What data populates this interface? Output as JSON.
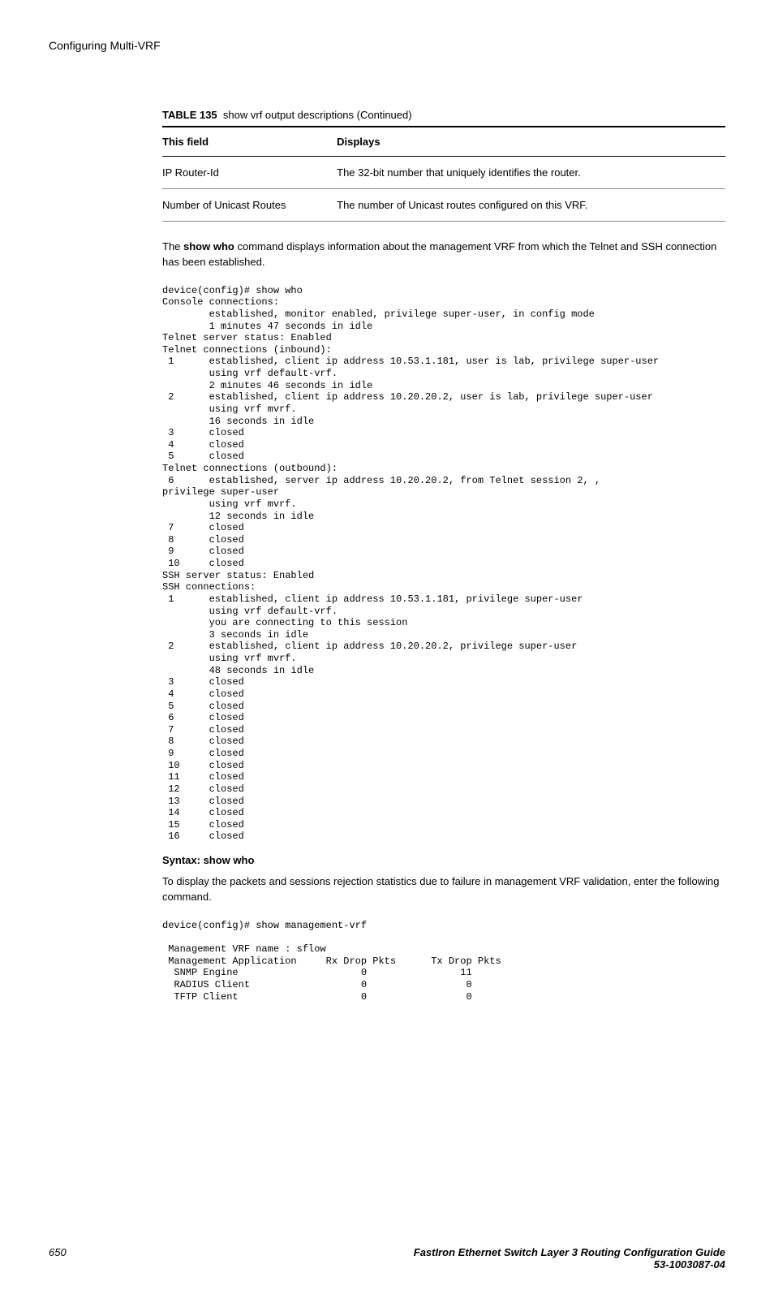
{
  "header": {
    "title": "Configuring Multi-VRF"
  },
  "table": {
    "caption_label": "TABLE 135",
    "caption_text": "show vrf output descriptions (Continued)",
    "head_field": "This field",
    "head_displays": "Displays",
    "rows": [
      {
        "field": "IP Router-Id",
        "displays": "The 32-bit number that uniquely identifies the router."
      },
      {
        "field": "Number of Unicast Routes",
        "displays": "The number of Unicast routes configured on this VRF."
      }
    ]
  },
  "paragraph1_pre": "The ",
  "paragraph1_bold": "show who",
  "paragraph1_post": " command displays information about the management VRF from which the Telnet and SSH connection has been established.",
  "console1": "device(config)# show who\nConsole connections:\n        established, monitor enabled, privilege super-user, in config mode\n        1 minutes 47 seconds in idle\nTelnet server status: Enabled\nTelnet connections (inbound):\n 1      established, client ip address 10.53.1.181, user is lab, privilege super-user\n        using vrf default-vrf.\n        2 minutes 46 seconds in idle\n 2      established, client ip address 10.20.20.2, user is lab, privilege super-user\n        using vrf mvrf.\n        16 seconds in idle\n 3      closed\n 4      closed\n 5      closed\nTelnet connections (outbound):\n 6      established, server ip address 10.20.20.2, from Telnet session 2, ,\nprivilege super-user\n        using vrf mvrf.\n        12 seconds in idle\n 7      closed\n 8      closed\n 9      closed\n 10     closed\nSSH server status: Enabled\nSSH connections:\n 1      established, client ip address 10.53.1.181, privilege super-user\n        using vrf default-vrf.\n        you are connecting to this session\n        3 seconds in idle\n 2      established, client ip address 10.20.20.2, privilege super-user\n        using vrf mvrf.\n        48 seconds in idle\n 3      closed\n 4      closed\n 5      closed\n 6      closed\n 7      closed\n 8      closed\n 9      closed\n 10     closed\n 11     closed\n 12     closed\n 13     closed\n 14     closed\n 15     closed\n 16     closed",
  "syntax_line": "Syntax: show who",
  "paragraph2": "To display the packets and sessions rejection statistics due to failure in management VRF validation, enter the following command.",
  "console2": "device(config)# show management-vrf\n\n Management VRF name : sflow\n Management Application     Rx Drop Pkts      Tx Drop Pkts\n  SNMP Engine                     0                11\n  RADIUS Client                   0                 0\n  TFTP Client                     0                 0",
  "footer": {
    "page": "650",
    "book": "FastIron Ethernet Switch Layer 3 Routing Configuration Guide",
    "docnum": "53-1003087-04"
  }
}
